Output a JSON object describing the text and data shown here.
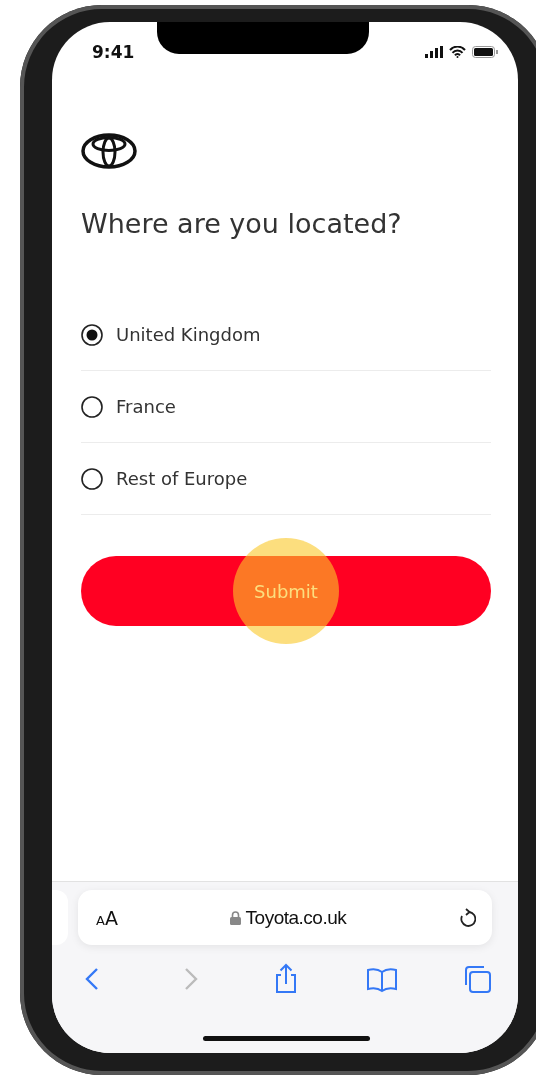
{
  "status_bar": {
    "time": "9:41"
  },
  "page": {
    "heading": "Where are you located?",
    "options": [
      {
        "label": "United Kingdom",
        "selected": true
      },
      {
        "label": "France",
        "selected": false
      },
      {
        "label": "Rest of Europe",
        "selected": false
      }
    ],
    "submit": {
      "label": "Submit"
    }
  },
  "browser": {
    "text_size": "AA",
    "url": "Toyota.co.uk",
    "back_disabled": false,
    "forward_disabled": true
  }
}
